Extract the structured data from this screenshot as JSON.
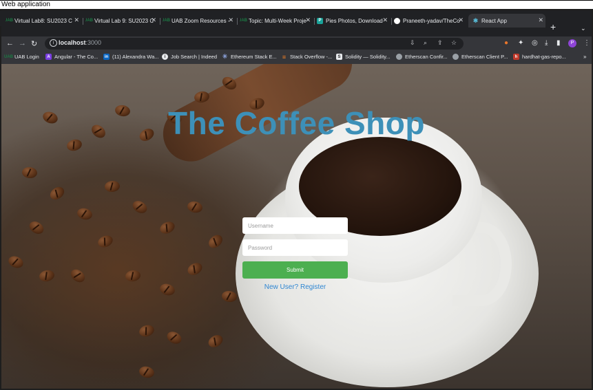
{
  "window_caption": "Web application",
  "tabs": [
    {
      "title": "Virtual Lab8: SU2023 C",
      "favicon": "UAB",
      "color": "#1b7a43"
    },
    {
      "title": "Virtual Lab 9: SU2023 C",
      "favicon": "UAB",
      "color": "#1b7a43"
    },
    {
      "title": "UAB Zoom Resources -",
      "favicon": "UAB",
      "color": "#1b7a43"
    },
    {
      "title": "Topic: Multi-Week Proje",
      "favicon": "UAB",
      "color": "#1b7a43"
    },
    {
      "title": "Pies Photos, Download",
      "favicon": "P",
      "color": "#1aa39a"
    },
    {
      "title": "Praneeth-yadav/TheCo",
      "favicon": "github",
      "color": "#ffffff"
    },
    {
      "title": "React App",
      "favicon": "react",
      "color": "#61dafb",
      "active": true
    }
  ],
  "address_bar": {
    "host": "localhost",
    "port": ":3000"
  },
  "profile_initial": "P",
  "bookmarks": [
    {
      "label": "UAB Login",
      "favicon": "UAB",
      "color": "#1b7a43"
    },
    {
      "label": "Angular - The Co...",
      "favicon": "A",
      "color": "#7b3fe4"
    },
    {
      "label": "(11) Alexandra Wa...",
      "favicon": "in",
      "color": "#0a66c2"
    },
    {
      "label": "Job Search | Indeed",
      "favicon": "i",
      "color": "#e8eaed"
    },
    {
      "label": "Ethereum Stack E...",
      "favicon": "eth",
      "color": "#8aa0d8"
    },
    {
      "label": "Stack Overflow -...",
      "favicon": "so",
      "color": "#f48024"
    },
    {
      "label": "Solidity — Solidity...",
      "favicon": "S",
      "color": "#e8eaed"
    },
    {
      "label": "Etherscan Confir...",
      "favicon": "e",
      "color": "#9aa0a6"
    },
    {
      "label": "Etherscan Client P...",
      "favicon": "e",
      "color": "#9aa0a6"
    },
    {
      "label": "hardhat-gas-repo...",
      "favicon": "h",
      "color": "#c0392b"
    }
  ],
  "page": {
    "heading": "The Coffee Shop",
    "username_placeholder": "Username",
    "password_placeholder": "Password",
    "submit_label": "Submit",
    "register_link": "New User? Register"
  },
  "colors": {
    "heading": "#3d90b8",
    "submit": "#4caf50",
    "link": "#2f86d2"
  }
}
